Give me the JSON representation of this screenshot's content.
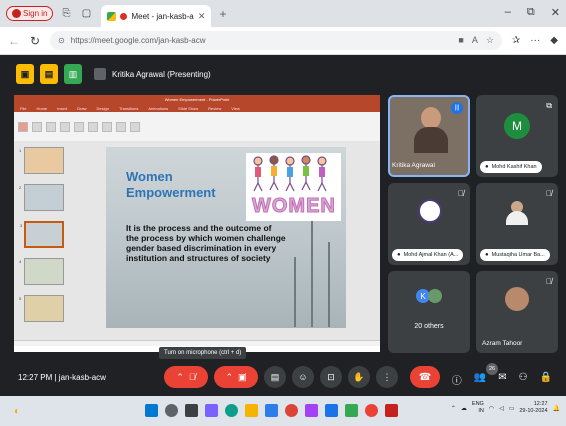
{
  "browser": {
    "sign_in": "Sign in",
    "tab_title": "Meet - jan-kasb-acw",
    "url": "https://meet.google.com/jan-kasb-acw",
    "new_tab": "+",
    "window_controls": [
      "–",
      "⧉",
      "✕"
    ]
  },
  "meet": {
    "presenter_label": "Kritika Agrawal (Presenting)",
    "tooltip": "Turn on microphone (ctrl + d)",
    "meeting_time": "12:27 PM",
    "meeting_code": "jan-kasb-acw",
    "participant_count": "26"
  },
  "slide": {
    "app_title": "Women Empowerment - PowerPoint",
    "ribbon_tabs": [
      "File",
      "Home",
      "Insert",
      "Draw",
      "Design",
      "Transitions",
      "Animations",
      "Slide Show",
      "Review",
      "View"
    ],
    "title_line1": "Women",
    "title_line2": "Empowerment",
    "body": "It is the process and the outcome of the process by which women challenge gender based discrimination in every institution and structures of society",
    "image_word": "WOMEN",
    "thumbnail_numbers": [
      "1",
      "2",
      "3",
      "4",
      "5"
    ]
  },
  "participants": [
    {
      "name": "Kritika Agrawal",
      "speaking": true
    },
    {
      "name": "Mohd Kashif Khan",
      "initial": "M"
    },
    {
      "name": "Mohd Ajmal Khan (A...",
      "muted": true
    },
    {
      "name": "Mustaqiha Umar Ba...",
      "muted": true
    },
    {
      "name": "20 others",
      "initial": "K"
    },
    {
      "name": "Azram Tahoor",
      "muted": true
    }
  ],
  "taskbar": {
    "lang": "ENG",
    "lang2": "IN",
    "time": "12:27",
    "date": "29-10-2024"
  },
  "colors": {
    "meet_bg": "#202124",
    "tile_bg": "#3c4043",
    "hangup": "#ea4335",
    "accent_blue": "#8ab4f8",
    "ppt_red": "#b7472a"
  }
}
